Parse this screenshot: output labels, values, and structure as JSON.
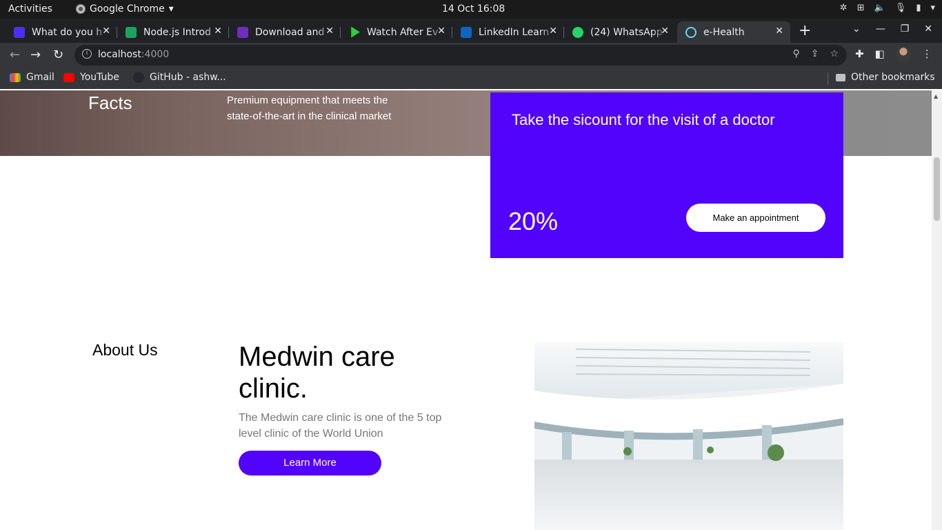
{
  "system_bar": {
    "activities": "Activities",
    "app_name": "Google Chrome",
    "clock": "14 Oct  16:08"
  },
  "tabs": [
    {
      "title": "What do you h",
      "favicon_color": "#4d2cff"
    },
    {
      "title": "Node.js Introd",
      "favicon_color": "#1aa260"
    },
    {
      "title": "Download and",
      "favicon_color": "#6f2dbd"
    },
    {
      "title": "Watch After Ev",
      "favicon_color": "#2ecc40"
    },
    {
      "title": "LinkedIn Learn",
      "favicon_color": "#0a66c2"
    },
    {
      "title": "(24) WhatsApp",
      "favicon_color": "#25d366"
    },
    {
      "title": "e-Health",
      "favicon_color": "#61dafb",
      "active": true
    }
  ],
  "address_bar": {
    "host": "localhost",
    "port": ":4000"
  },
  "bookmarks": [
    {
      "label": "Gmail",
      "icon": "gmail-icon"
    },
    {
      "label": "YouTube",
      "icon": "youtube-icon"
    },
    {
      "label": "GitHub - ashw...",
      "icon": "github-icon"
    }
  ],
  "other_bookmarks": "Other bookmarks",
  "page": {
    "facts_heading": "Facts",
    "facts_description": "Premium equipment that meets the state-of-the-art in the clinical market",
    "promo": {
      "title": "Take the sicount for the visit of a doctor",
      "discount": "20%",
      "button": "Make an appointment",
      "color": "#5203fc"
    },
    "about_label": "About Us",
    "clinic_title": "Medwin care clinic.",
    "clinic_description": "The Medwin care clinic is one of the 5 top level clinic of the World Union",
    "learn_more": "Learn More"
  }
}
